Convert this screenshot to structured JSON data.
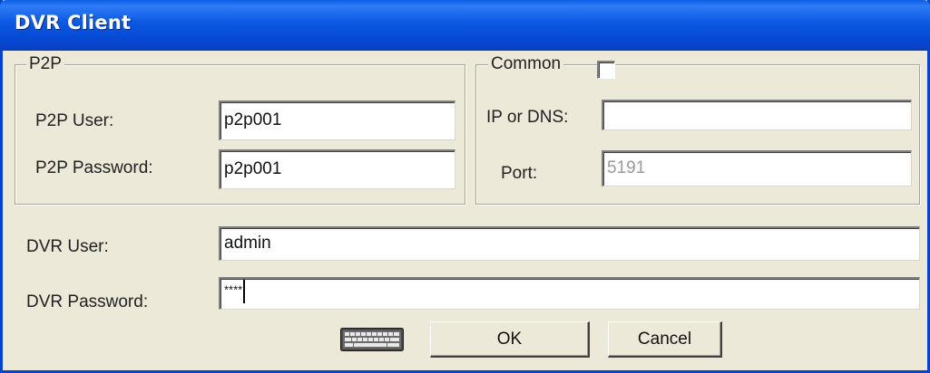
{
  "window": {
    "title": "DVR Client"
  },
  "p2p_group": {
    "legend": "P2P",
    "user_label": "P2P User:",
    "user_value": "p2p001",
    "password_label": "P2P Password:",
    "password_value": "p2p001"
  },
  "common_group": {
    "legend": "Common",
    "checkbox_checked": false,
    "ip_label": "IP or DNS:",
    "ip_value": "",
    "port_label": "Port:",
    "port_value": "5191"
  },
  "dvr": {
    "user_label": "DVR User:",
    "user_value": "admin",
    "password_label": "DVR Password:",
    "password_value": "****"
  },
  "buttons": {
    "keyboard_icon": "keyboard-icon",
    "ok_label": "OK",
    "cancel_label": "Cancel"
  },
  "colors": {
    "titlebar": "#0a58e2",
    "face": "#ece9d8"
  }
}
